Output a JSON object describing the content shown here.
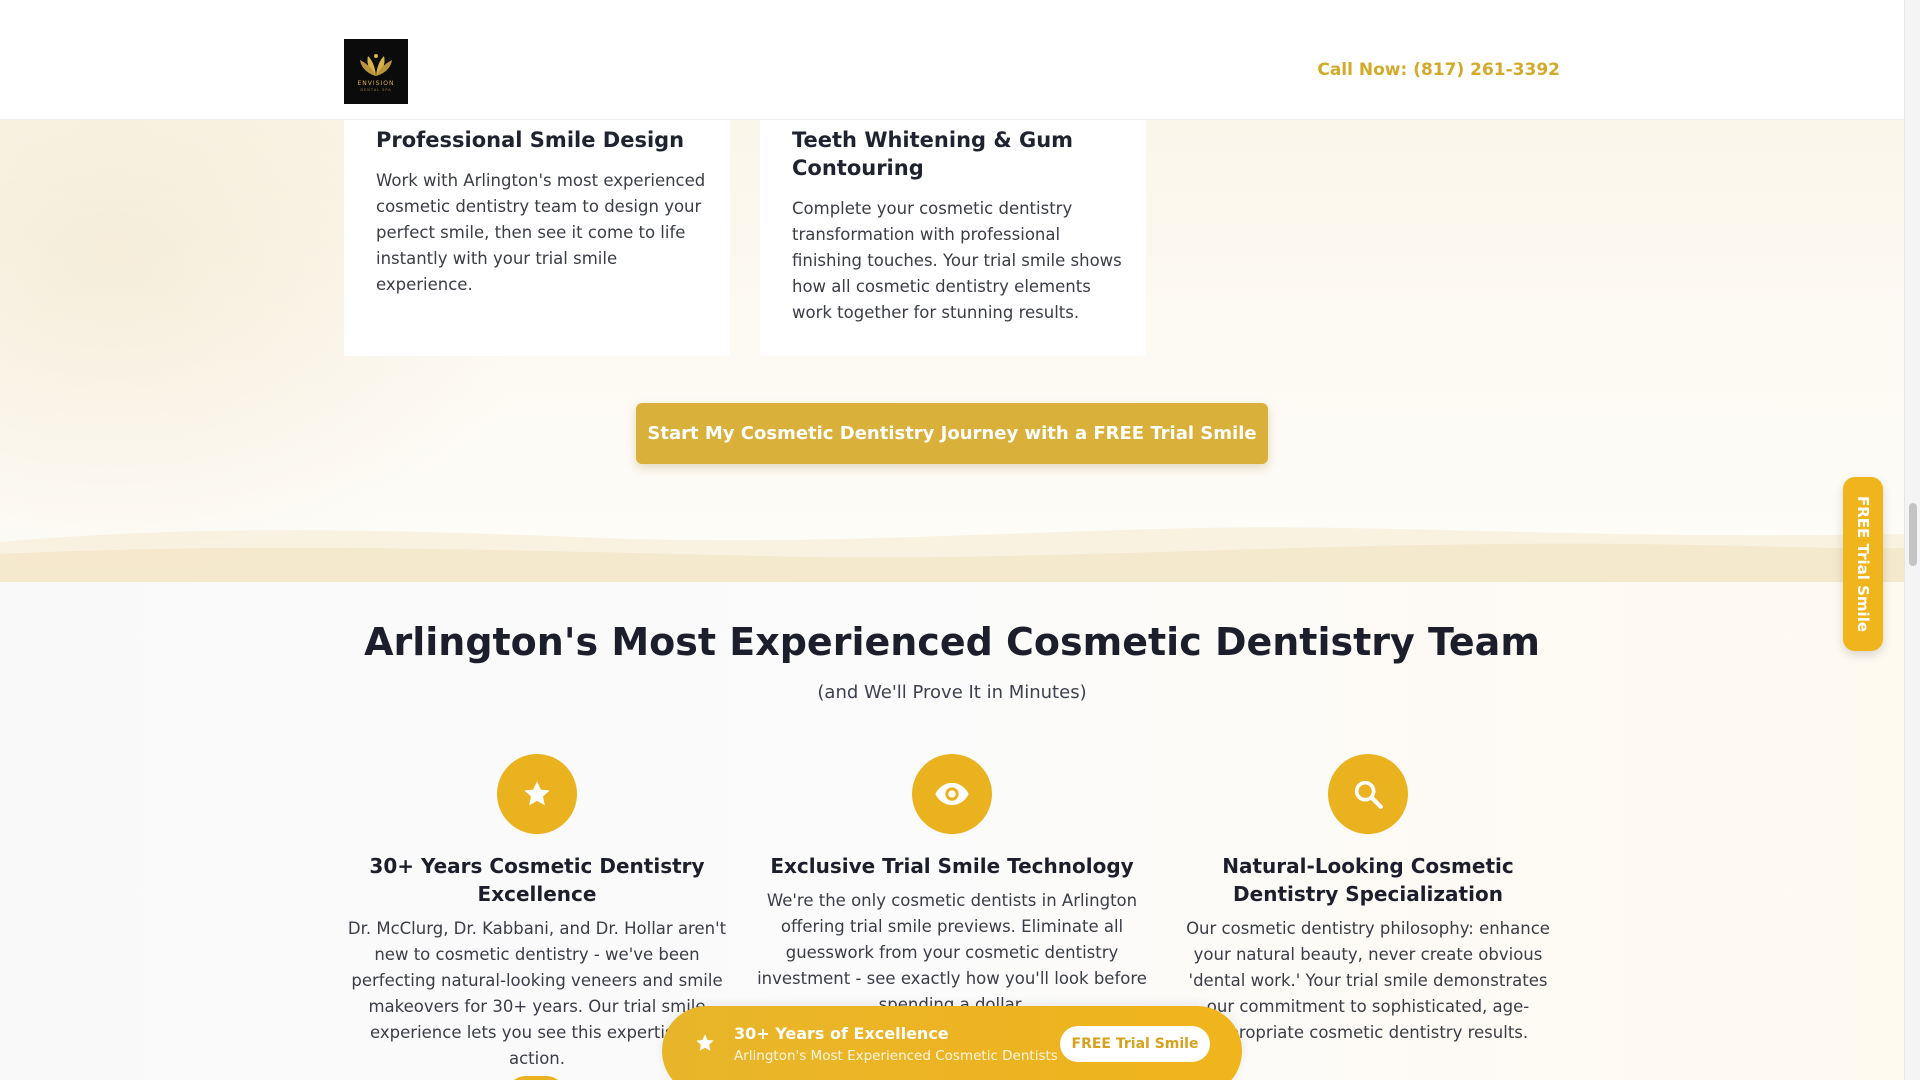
{
  "header": {
    "logo_name": "ENVISION",
    "logo_sub": "DENTAL SPA",
    "phone": "Call Now: (817) 261-3392"
  },
  "services": [
    {
      "title": "Professional Smile Design",
      "text": "Work with Arlington's most experienced cosmetic dentistry team to design your perfect smile, then see it come to life instantly with your trial smile experience."
    },
    {
      "title": "Teeth Whitening & Gum Contouring",
      "text": "Complete your cosmetic dentistry transformation with professional finishing touches. Your trial smile shows how all cosmetic dentistry elements work together for stunning results."
    }
  ],
  "cta": {
    "label": "Start My Cosmetic Dentistry Journey with a FREE Trial Smile"
  },
  "team_section": {
    "title": "Arlington's Most Experienced Cosmetic Dentistry Team",
    "subtitle": "(and We'll Prove It in Minutes)",
    "features": [
      {
        "icon": "star-icon",
        "title": "30+ Years Cosmetic Dentistry Excellence",
        "text": "Dr. McClurg, Dr. Kabbani, and Dr. Hollar aren't new to cosmetic dentistry - we've been perfecting natural-looking veneers and smile makeovers for 30+ years. Our trial smile experience lets you see this expertise in action."
      },
      {
        "icon": "eye-icon",
        "title": "Exclusive Trial Smile Technology",
        "text": "We're the only cosmetic dentists in Arlington offering trial smile previews. Eliminate all guesswork from your cosmetic dentistry investment - see exactly how you'll look before spending a dollar."
      },
      {
        "icon": "search-icon",
        "title": "Natural-Looking Cosmetic Dentistry Specialization",
        "text": "Our cosmetic dentistry philosophy: enhance your natural beauty, never create obvious 'dental work.' Your trial smile demonstrates our commitment to sophisticated, age-appropriate cosmetic dentistry results."
      }
    ]
  },
  "side_tab": {
    "label": "FREE Trial Smile"
  },
  "float_bar": {
    "icon": "star-icon",
    "title": "30+ Years of Excellence",
    "subtitle": "Arlington's Most Experienced Cosmetic Dentists",
    "button": "FREE Trial Smile"
  },
  "colors": {
    "accent": "#e9b21e",
    "cta": "#d8b03a",
    "phone": "#d3a928"
  }
}
